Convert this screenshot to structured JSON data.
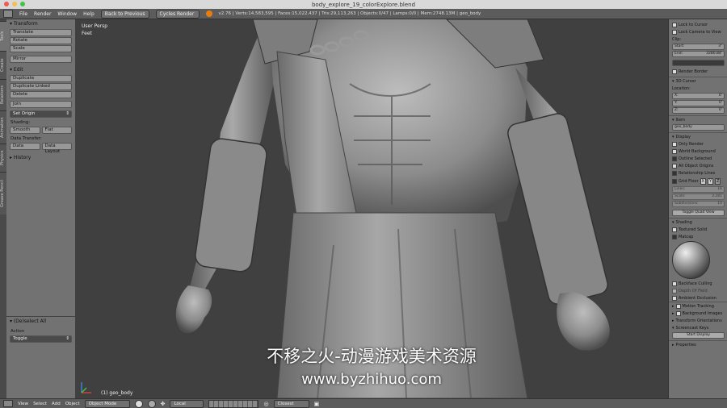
{
  "window": {
    "title": "body_explore_19_colorExplore.blend"
  },
  "menubar": {
    "items": [
      "File",
      "Render",
      "Window",
      "Help"
    ],
    "back_button": "Back to Previous",
    "engine": "Cycles Render",
    "stats": "v2.76 | Verts:14,583,595 | Faces:15,022,437 | Tris:29,113,263 | Objects:0/47 | Lamps:0/0 | Mem:2748.13M | geo_body"
  },
  "tabs": [
    "Tools",
    "Create",
    "Relations",
    "Animation",
    "Physics",
    "Grease Pencil"
  ],
  "left_panel": {
    "transform_header": "Transform",
    "transform_buttons": [
      "Translate",
      "Rotate",
      "Scale",
      "Mirror"
    ],
    "edit_header": "Edit",
    "edit_buttons": [
      "Duplicate",
      "Duplicate Linked",
      "Delete",
      "Join"
    ],
    "set_origin": "Set Origin",
    "shading_label": "Shading:",
    "shading_buttons": [
      "Smooth",
      "Flat"
    ],
    "data_transfer_label": "Data Transfer:",
    "data_buttons": [
      "Data",
      "Data Layout"
    ],
    "history_header": "History",
    "operator_header": "(De)select All",
    "action_label": "Action",
    "action_value": "Toggle"
  },
  "viewport": {
    "view_label": "User Persp",
    "units_label": "Feet",
    "object_label": "(1) geo_body"
  },
  "right_panel": {
    "lock_cursor": "Lock to Cursor",
    "lock_camera": "Lock Camera to View",
    "clip_label": "Clip:",
    "clip_start_label": "Start:",
    "clip_start_value": "3\"",
    "clip_end_label": "End:",
    "clip_end_value": "3280.84'",
    "render_border": "Render Border",
    "cursor_header": "3D Cursor",
    "location_label": "Location:",
    "cursor_x_label": "X:",
    "cursor_x_value": "0'",
    "cursor_y_label": "Y:",
    "cursor_y_value": "0'",
    "cursor_z_label": "Z:",
    "cursor_z_value": "0'",
    "item_header": "Item",
    "item_name": "geo_body",
    "display_header": "Display",
    "display_options": [
      {
        "label": "Only Render",
        "on": false
      },
      {
        "label": "World Background",
        "on": false
      },
      {
        "label": "Outline Selected",
        "on": true
      },
      {
        "label": "All Object Origins",
        "on": false
      },
      {
        "label": "Relationship Lines",
        "on": true
      }
    ],
    "grid_floor": "Grid Floor",
    "grid_x": "X",
    "grid_y": "Y",
    "grid_z": "Z",
    "lines_label": "Lines:",
    "lines_value": "16",
    "scale_label": "Scale:",
    "scale_value": "3.281",
    "subdivisions_label": "Subdivisions:",
    "subdivisions_value": "10",
    "toggle_quad": "Toggle Quad View",
    "shading_header": "Shading",
    "textured_solid": "Textured Solid",
    "matcap": "Matcap",
    "backface_culling": "Backface Culling",
    "depth_of_field": "Depth Of Field",
    "ambient_occlusion": "Ambient Occlusion",
    "collapsed_panels": [
      "Motion Tracking",
      "Background Images",
      "Transform Orientations",
      "Screencast Keys"
    ],
    "start_display": "Start Display",
    "properties_header": "Properties"
  },
  "bottom_bar": {
    "items": [
      "View",
      "Select",
      "Add",
      "Object"
    ],
    "mode": "Object Mode",
    "orientation": "Local",
    "pivot": "Closest"
  },
  "watermark": {
    "line1": "不移之火-动漫游戏美术资源",
    "line2": "www.byzhihuo.com"
  },
  "colors": {
    "panel_bg": "#727272",
    "viewport_bg": "#404040",
    "header_bg": "#5c5c5c"
  }
}
